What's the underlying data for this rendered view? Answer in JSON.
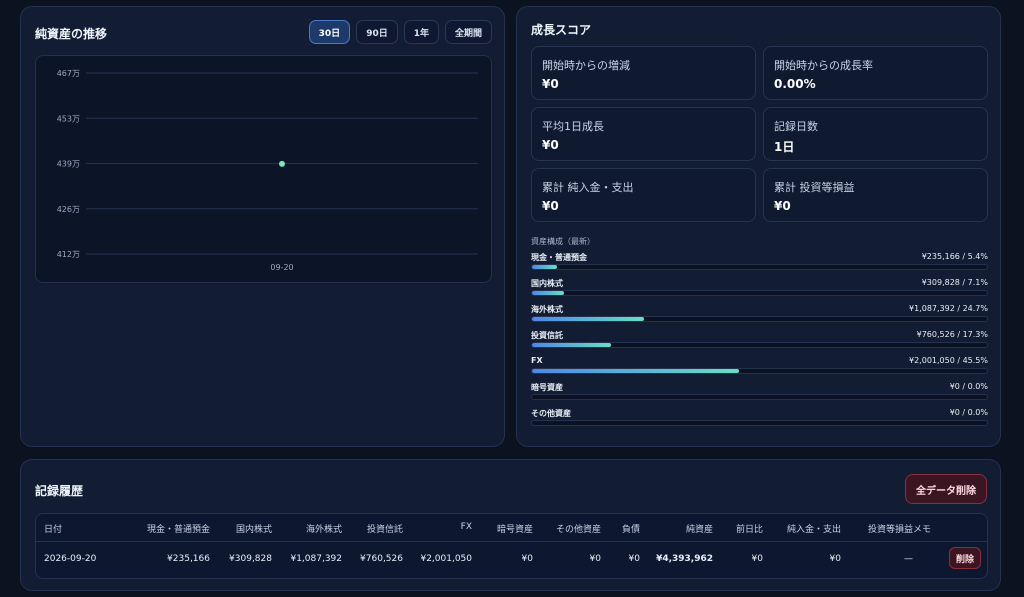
{
  "chart_card": {
    "title": "純資産の推移",
    "ranges": [
      "30日",
      "90日",
      "1年",
      "全期間"
    ],
    "active_range": "30日"
  },
  "chart_data": {
    "type": "line",
    "x": [
      "09-20"
    ],
    "series": [
      {
        "values": [
          439.4
        ]
      }
    ],
    "y_ticks": [
      "467万",
      "453万",
      "439万",
      "426万",
      "412万"
    ],
    "ylim": [
      412,
      467
    ],
    "grid": true,
    "colors": {
      "point": "#7ee3b8",
      "grid": "#23314f"
    }
  },
  "score_card": {
    "title": "成長スコア",
    "stats": [
      {
        "label": "開始時からの増減",
        "value": "¥0"
      },
      {
        "label": "開始時からの成長率",
        "value": "0.00%"
      },
      {
        "label": "平均1日成長",
        "value": "¥0"
      },
      {
        "label": "記録日数",
        "value": "1日"
      },
      {
        "label": "累計 純入金・支出",
        "value": "¥0"
      },
      {
        "label": "累計 投資等損益",
        "value": "¥0"
      }
    ],
    "composition_title": "資産構成（最新）",
    "composition": [
      {
        "name": "現金・普通預金",
        "value": "¥235,166 / 5.4%",
        "pct": 5.4
      },
      {
        "name": "国内株式",
        "value": "¥309,828 / 7.1%",
        "pct": 7.1
      },
      {
        "name": "海外株式",
        "value": "¥1,087,392 / 24.7%",
        "pct": 24.7
      },
      {
        "name": "投資信託",
        "value": "¥760,526 / 17.3%",
        "pct": 17.3
      },
      {
        "name": "FX",
        "value": "¥2,001,050 / 45.5%",
        "pct": 45.5
      },
      {
        "name": "暗号資産",
        "value": "¥0 / 0.0%",
        "pct": 0
      },
      {
        "name": "その他資産",
        "value": "¥0 / 0.0%",
        "pct": 0
      }
    ]
  },
  "history": {
    "title": "記録履歴",
    "delete_all_label": "全データ削除",
    "columns": [
      "日付",
      "現金・普通預金",
      "国内株式",
      "海外株式",
      "投資信託",
      "FX",
      "暗号資産",
      "その他資産",
      "負債",
      "純資産",
      "前日比",
      "純入金・支出",
      "投資等損益",
      "メモ"
    ],
    "rows": [
      {
        "date": "2026-09-20",
        "cash": "¥235,166",
        "domestic": "¥309,828",
        "foreign": "¥1,087,392",
        "fund": "¥760,526",
        "fx": "¥2,001,050",
        "crypto": "¥0",
        "other": "¥0",
        "liabilities": "¥0",
        "net": "¥4,393,962",
        "dod": "¥0",
        "deposit": "¥0",
        "pnl": "—",
        "memo": "",
        "delete_label": "削除"
      }
    ]
  }
}
